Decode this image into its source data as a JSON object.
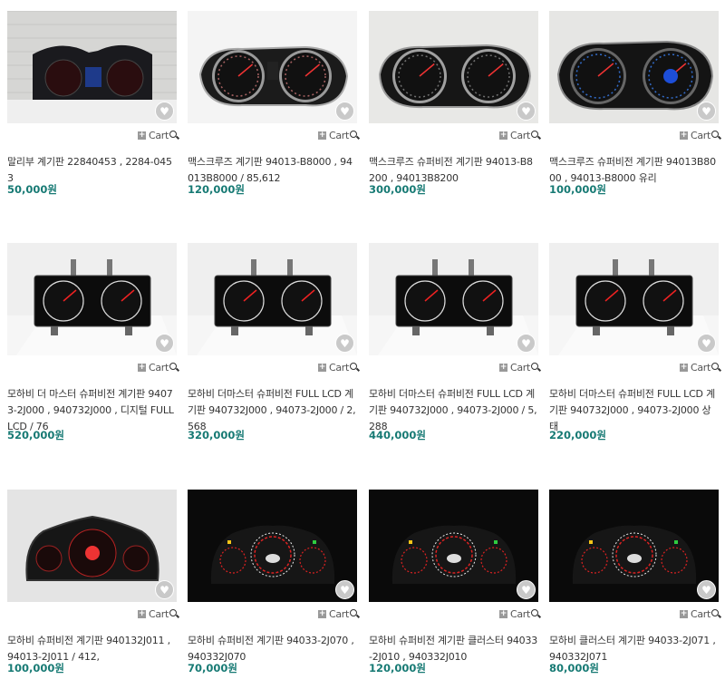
{
  "cart_label": "Cart",
  "products": [
    {
      "title": "말리부 계기판 22840453 , 2284-0453",
      "price": "50,000원",
      "style": "malibu"
    },
    {
      "title": "맥스크루즈 계기판 94013-B8000 , 94013B8000 / 85,612",
      "price": "120,000원",
      "style": "max"
    },
    {
      "title": "맥스크루즈 슈퍼비전 계기판 94013-B8200 , 94013B8200",
      "price": "300,000원",
      "style": "max2"
    },
    {
      "title": "맥스크루즈 슈퍼비전 계기판 94013B8000 , 94013-B8000 유리",
      "price": "100,000원",
      "style": "max3"
    },
    {
      "title": "모하비 더 마스터 슈퍼비전 계기판 94073-2J000 , 940732J000 , 디지털 FULL LCD / 76",
      "price": "520,000원",
      "style": "lcd"
    },
    {
      "title": "모하비 더마스터 슈퍼비전 FULL LCD 계기판 940732J000 , 94073-2J000 / 2,568",
      "price": "320,000원",
      "style": "lcd"
    },
    {
      "title": "모하비 더마스터 슈퍼비전 FULL LCD 계기판 940732J000 , 94073-2J000 / 5,288",
      "price": "440,000원",
      "style": "lcd"
    },
    {
      "title": "모하비 더마스터 슈퍼비전 FULL LCD 계기판 940732J000 , 94073-2J000 상태",
      "price": "220,000원",
      "style": "lcd"
    },
    {
      "title": "모하비 슈퍼비전 계기판 940132J011 , 94013-2J011 / 412,",
      "price": "100,000원",
      "style": "mohave"
    },
    {
      "title": "모하비 슈퍼비전 계기판 94033-2J070 , 940332J070",
      "price": "70,000원",
      "style": "kia"
    },
    {
      "title": "모하비 슈퍼비전 계기판 클러스터 94033-2J010 , 940332J010",
      "price": "120,000원",
      "style": "kia"
    },
    {
      "title": "모하비 클러스터 계기판 94033-2J071 , 940332J071",
      "price": "80,000원",
      "style": "kia"
    }
  ]
}
